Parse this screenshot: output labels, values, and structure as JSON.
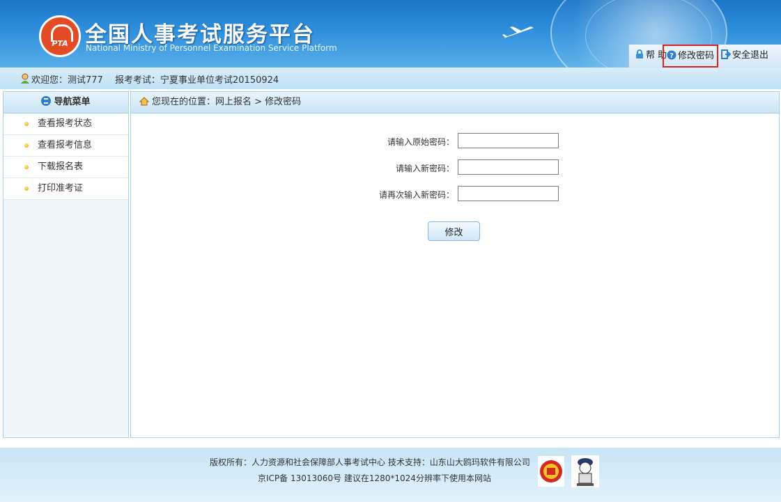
{
  "header": {
    "logo_text": "PTA",
    "title_cn": "全国人事考试服务平台",
    "title_en": "National Ministry of Personnel Examination Service Platform",
    "links": {
      "help": "帮 助",
      "change_password": "修改密码",
      "logout": "安全退出"
    }
  },
  "welcome": {
    "user": "欢迎您：测试777",
    "exam": "报考考试：宁夏事业单位考试20150924"
  },
  "sidebar": {
    "title": "导航菜单",
    "items": [
      {
        "label": "查看报考状态"
      },
      {
        "label": "查看报考信息"
      },
      {
        "label": "下载报名表"
      },
      {
        "label": "打印准考证"
      }
    ]
  },
  "main": {
    "breadcrumb": "您现在的位置：网上报名 > 修改密码",
    "form": {
      "old_password_label": "请输入原始密码：",
      "old_password_value": "",
      "new_password_label": "请输入新密码：",
      "new_password_value": "",
      "confirm_password_label": "请再次输入新密码：",
      "confirm_password_value": "",
      "submit_label": "修改"
    }
  },
  "footer": {
    "line1": "版权所有：人力资源和社会保障部人事考试中心  技术支持：山东山大鸥玛软件有限公司",
    "line2": "京ICP备 13013060号  建议在1280*1024分辨率下使用本网站"
  },
  "colors": {
    "header_blue": "#1a76c8",
    "highlight_red": "#e02020",
    "logo_orange": "#e34b24"
  }
}
